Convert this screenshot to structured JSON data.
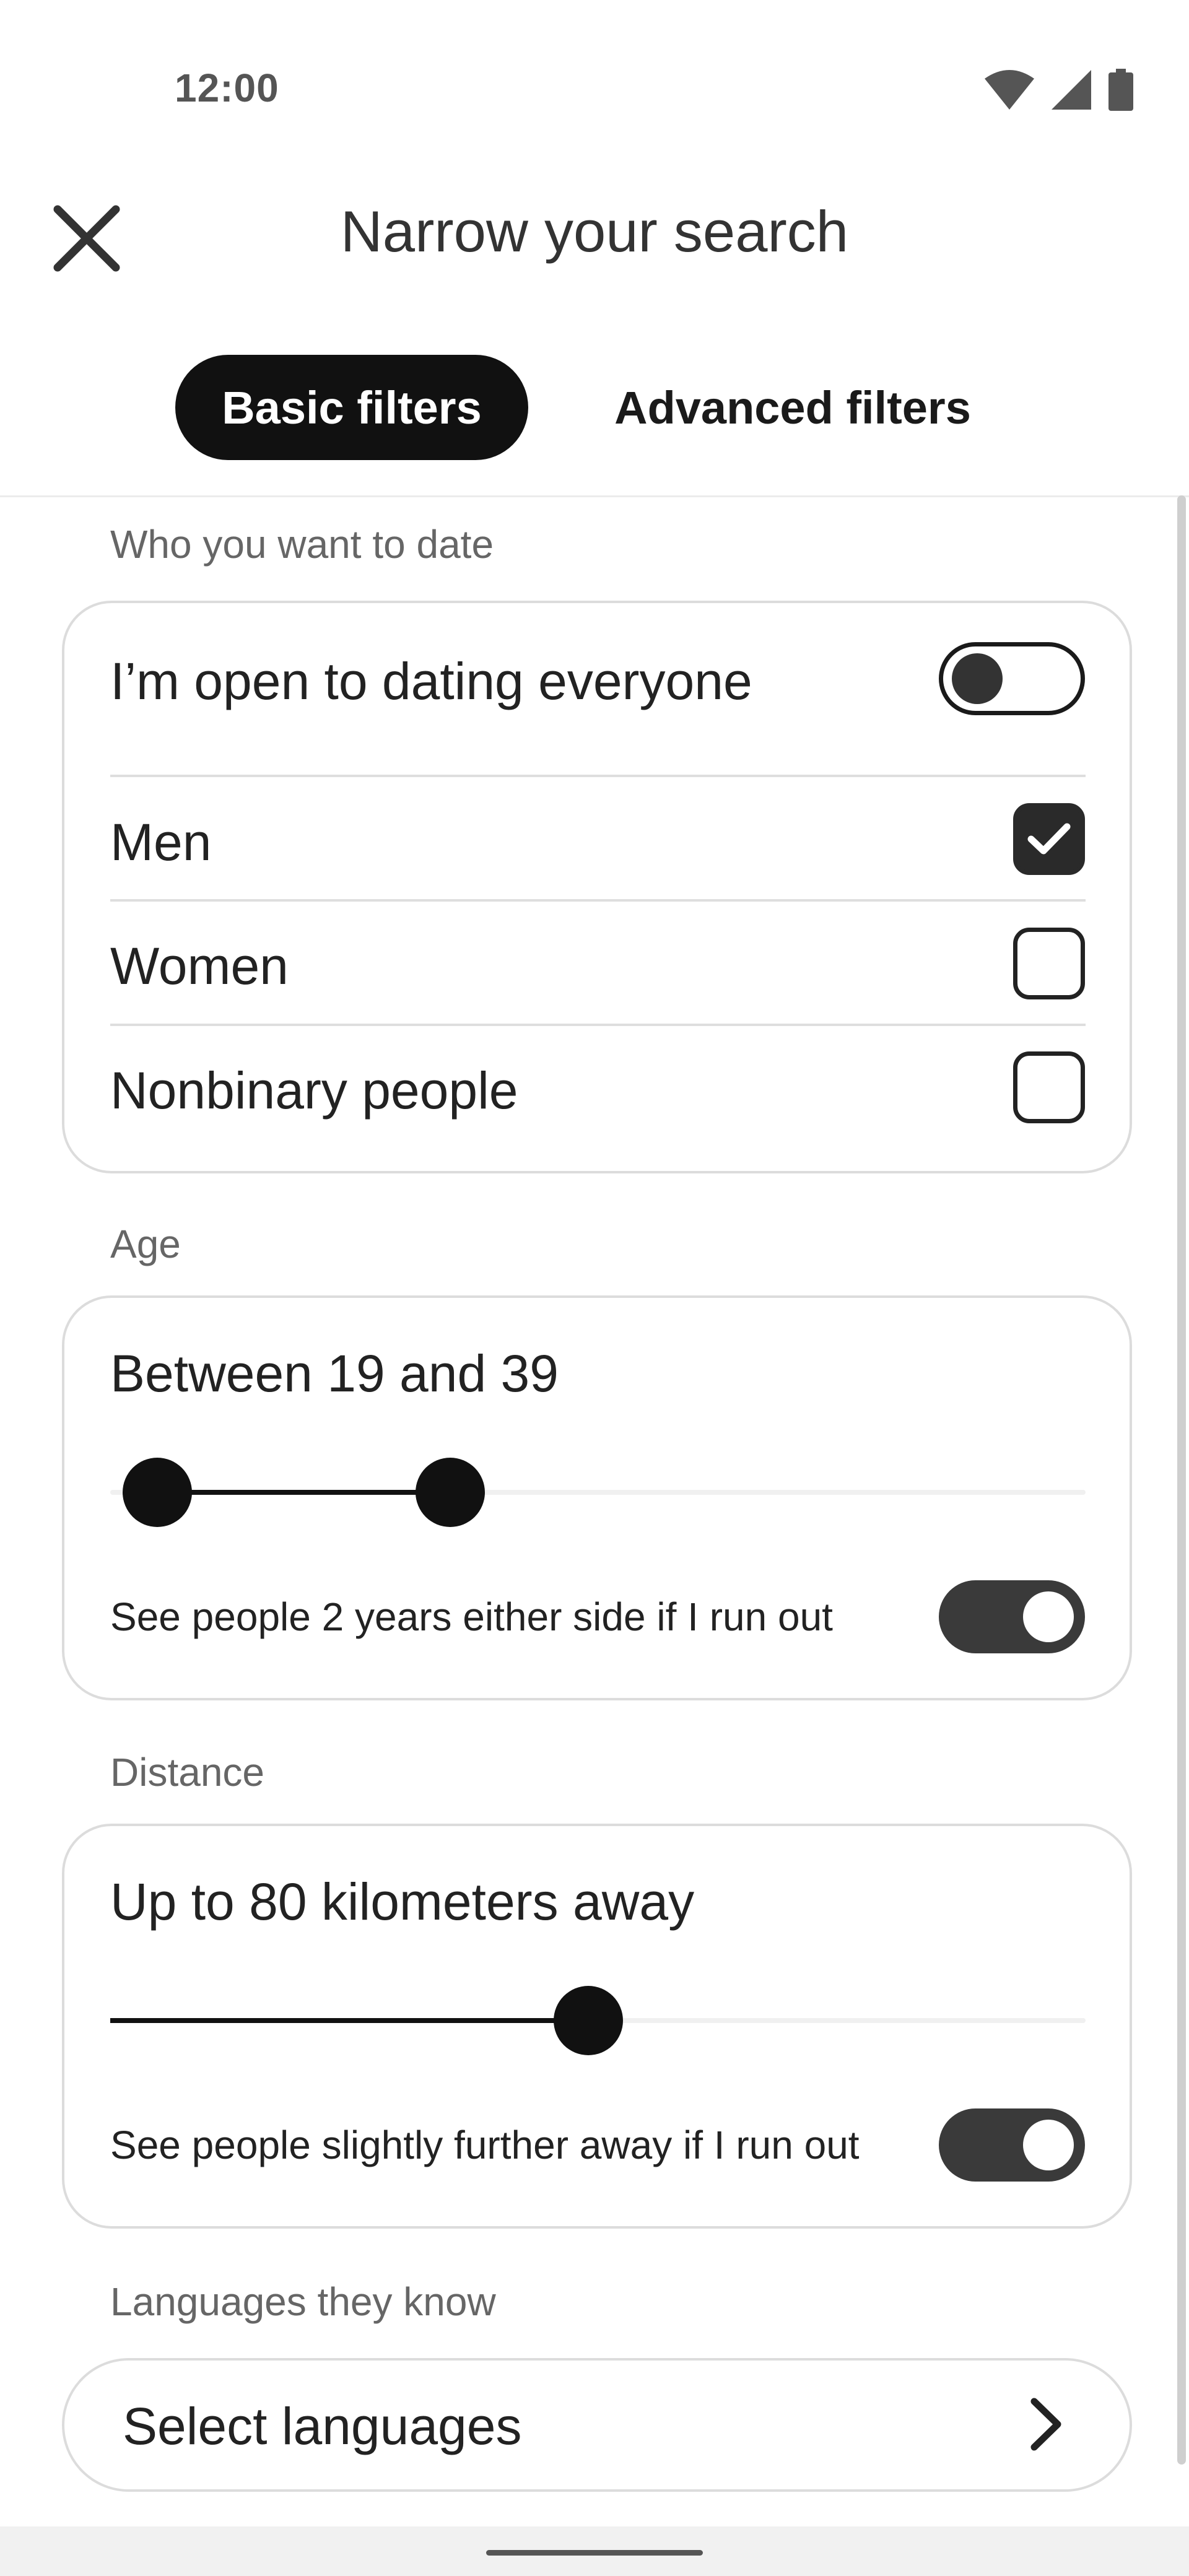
{
  "status_bar": {
    "time": "12:00",
    "icons": [
      "wifi-icon",
      "signal-icon",
      "battery-icon"
    ]
  },
  "header": {
    "title": "Narrow your search",
    "close_icon": "close-icon"
  },
  "tabs": [
    {
      "label": "Basic filters",
      "active": true
    },
    {
      "label": "Advanced filters",
      "active": false
    }
  ],
  "who": {
    "section_label": "Who you want to date",
    "open_everyone_label": "I’m open to dating everyone",
    "open_everyone_on": false,
    "options": [
      {
        "label": "Men",
        "checked": true
      },
      {
        "label": "Women",
        "checked": false
      },
      {
        "label": "Nonbinary people",
        "checked": false
      }
    ]
  },
  "age": {
    "section_label": "Age",
    "range_label": "Between 19 and 39",
    "min": 19,
    "max": 39,
    "expand_label": "See people 2 years either side if I run out",
    "expand_on": true
  },
  "distance": {
    "section_label": "Distance",
    "value_label": "Up to 80 kilometers away",
    "value_km": 80,
    "expand_label": "See people slightly further away if I run out",
    "expand_on": true
  },
  "languages": {
    "section_label": "Languages they know",
    "button_label": "Select languages"
  },
  "colors": {
    "accent": "#111111",
    "toggle_on": "#3a3a3a",
    "border": "#dcdcdc"
  }
}
